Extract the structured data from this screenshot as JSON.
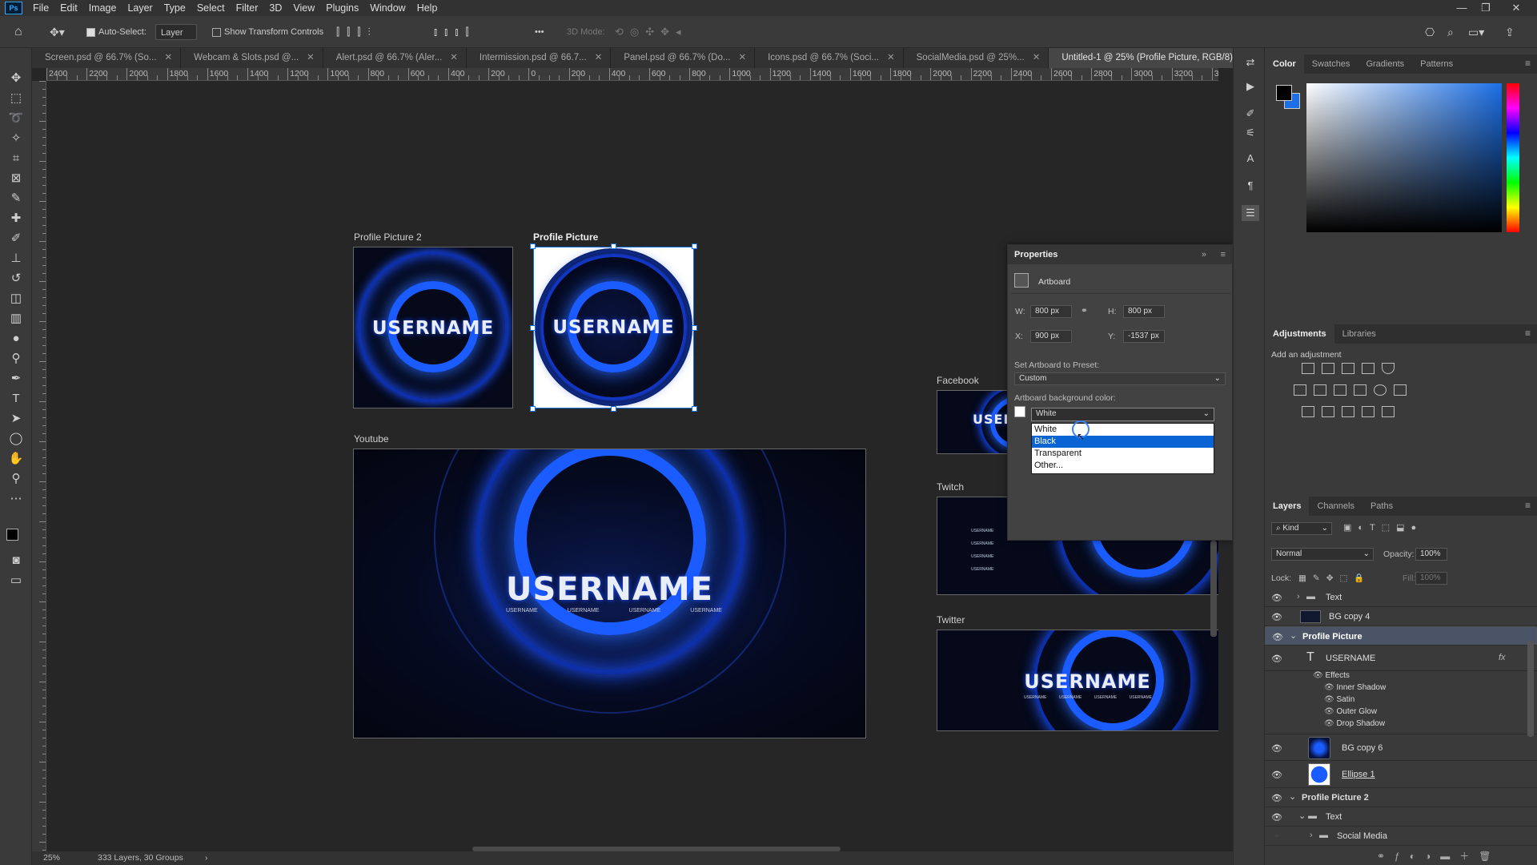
{
  "app": {
    "logo": "Ps"
  },
  "menu": [
    "File",
    "Edit",
    "Image",
    "Layer",
    "Type",
    "Select",
    "Filter",
    "3D",
    "View",
    "Plugins",
    "Window",
    "Help"
  ],
  "options": {
    "auto_select": "Auto-Select:",
    "layer_select": "Layer",
    "show_transform": "Show Transform Controls",
    "mode_3d": "3D Mode:",
    "more": "•••"
  },
  "tabs": [
    {
      "label": "Screen.psd @ 66.7% (So...",
      "active": false
    },
    {
      "label": "Webcam & Slots.psd @...",
      "active": false
    },
    {
      "label": "Alert.psd @ 66.7% (Aler...",
      "active": false
    },
    {
      "label": "Intermission.psd @ 66.7...",
      "active": false
    },
    {
      "label": "Panel.psd @ 66.7% (Do...",
      "active": false
    },
    {
      "label": "Icons.psd @ 66.7% (Soci...",
      "active": false
    },
    {
      "label": "SocialMedia.psd @ 25%...",
      "active": false
    },
    {
      "label": "Untitled-1 @ 25% (Profile Picture, RGB/8) *",
      "active": true
    }
  ],
  "ruler_h": [
    "2400",
    "2200",
    "2000",
    "1800",
    "1600",
    "1400",
    "1200",
    "1000",
    "800",
    "600",
    "400",
    "200",
    "0",
    "200",
    "400",
    "600",
    "800",
    "1000",
    "1200",
    "1400",
    "1600",
    "1800",
    "2000",
    "2200",
    "2400",
    "2600",
    "2800",
    "3000",
    "3200",
    "3"
  ],
  "artboards": {
    "pp2_label": "Profile Picture 2",
    "pp_label": "Profile Picture",
    "youtube_label": "Youtube",
    "facebook_label": "Facebook",
    "twitch_label": "Twitch",
    "twitter_label": "Twitter",
    "username": "USERNAME",
    "social_handle": "USERNAME"
  },
  "properties": {
    "title": "Properties",
    "type": "Artboard",
    "w_label": "W:",
    "w": "800 px",
    "h_label": "H:",
    "h": "800 px",
    "x_label": "X:",
    "x": "900 px",
    "y_label": "Y:",
    "y": "-1537 px",
    "preset_label": "Set Artboard to Preset:",
    "preset": "Custom",
    "bg_label": "Artboard background color:",
    "bg_value": "White",
    "bg_options": [
      "White",
      "Black",
      "Transparent",
      "Other..."
    ],
    "bg_highlighted": "Black"
  },
  "color_panel": {
    "tabs": [
      "Color",
      "Swatches",
      "Gradients",
      "Patterns"
    ],
    "fg": "#000000",
    "bg": "#1c6fe6"
  },
  "adjustments": {
    "tabs": [
      "Adjustments",
      "Libraries"
    ],
    "hint": "Add an adjustment"
  },
  "layers_panel": {
    "tabs": [
      "Layers",
      "Channels",
      "Paths"
    ],
    "kind": "Kind",
    "blend": "Normal",
    "opacity_label": "Opacity:",
    "opacity": "100%",
    "lock_label": "Lock:",
    "fill_label": "Fill:",
    "fill": "100%",
    "layers": [
      {
        "name": "Text",
        "kind": "group"
      },
      {
        "name": "BG copy 4",
        "kind": "layer"
      },
      {
        "name": "Profile Picture",
        "kind": "artboard"
      },
      {
        "name": "USERNAME",
        "kind": "text"
      },
      {
        "name": "Effects",
        "kind": "effects"
      },
      {
        "name": "Inner Shadow",
        "kind": "effect"
      },
      {
        "name": "Satin",
        "kind": "effect"
      },
      {
        "name": "Outer Glow",
        "kind": "effect"
      },
      {
        "name": "Drop Shadow",
        "kind": "effect"
      },
      {
        "name": "BG copy 6",
        "kind": "layer"
      },
      {
        "name": "Ellipse 1",
        "kind": "shape"
      },
      {
        "name": "Profile Picture 2",
        "kind": "artboard"
      },
      {
        "name": "Text",
        "kind": "group"
      },
      {
        "name": "Social Media",
        "kind": "group"
      }
    ]
  },
  "status": {
    "zoom": "25%",
    "info": "333 Layers, 30 Groups"
  }
}
